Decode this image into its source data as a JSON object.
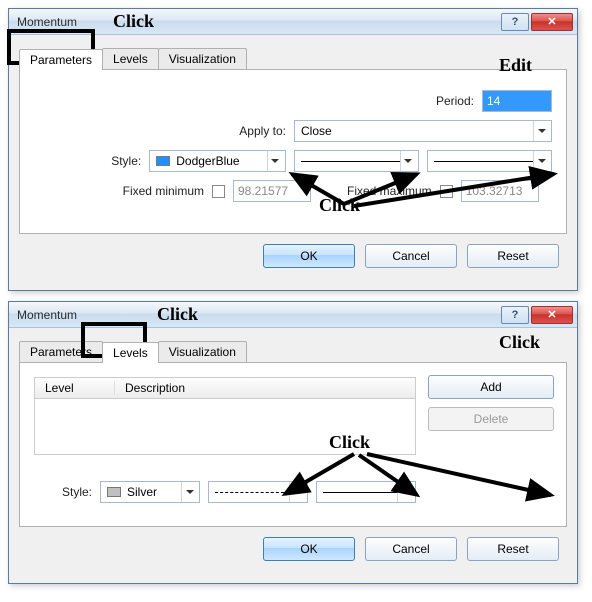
{
  "dialog1": {
    "title": "Momentum",
    "tabs": {
      "parameters": "Parameters",
      "levels": "Levels",
      "visualization": "Visualization"
    },
    "period_label": "Period:",
    "period_value": "14",
    "applyto_label": "Apply to:",
    "applyto_value": "Close",
    "style_label": "Style:",
    "style_color": "DodgerBlue",
    "fixedmin_label": "Fixed minimum",
    "fixedmin_value": "98.21577",
    "fixedmax_label": "Fixed maximum",
    "fixedmax_value": "103.32713",
    "buttons": {
      "ok": "OK",
      "cancel": "Cancel",
      "reset": "Reset"
    },
    "annot": {
      "click_tab": "Click",
      "edit": "Edit",
      "click_style": "Click"
    }
  },
  "dialog2": {
    "title": "Momentum",
    "tabs": {
      "parameters": "Parameters",
      "levels": "Levels",
      "visualization": "Visualization"
    },
    "list": {
      "col_level": "Level",
      "col_desc": "Description"
    },
    "add": "Add",
    "delete": "Delete",
    "style_label": "Style:",
    "style_color": "Silver",
    "buttons": {
      "ok": "OK",
      "cancel": "Cancel",
      "reset": "Reset"
    },
    "annot": {
      "click_tab": "Click",
      "click_add": "Click",
      "click_style": "Click"
    }
  }
}
